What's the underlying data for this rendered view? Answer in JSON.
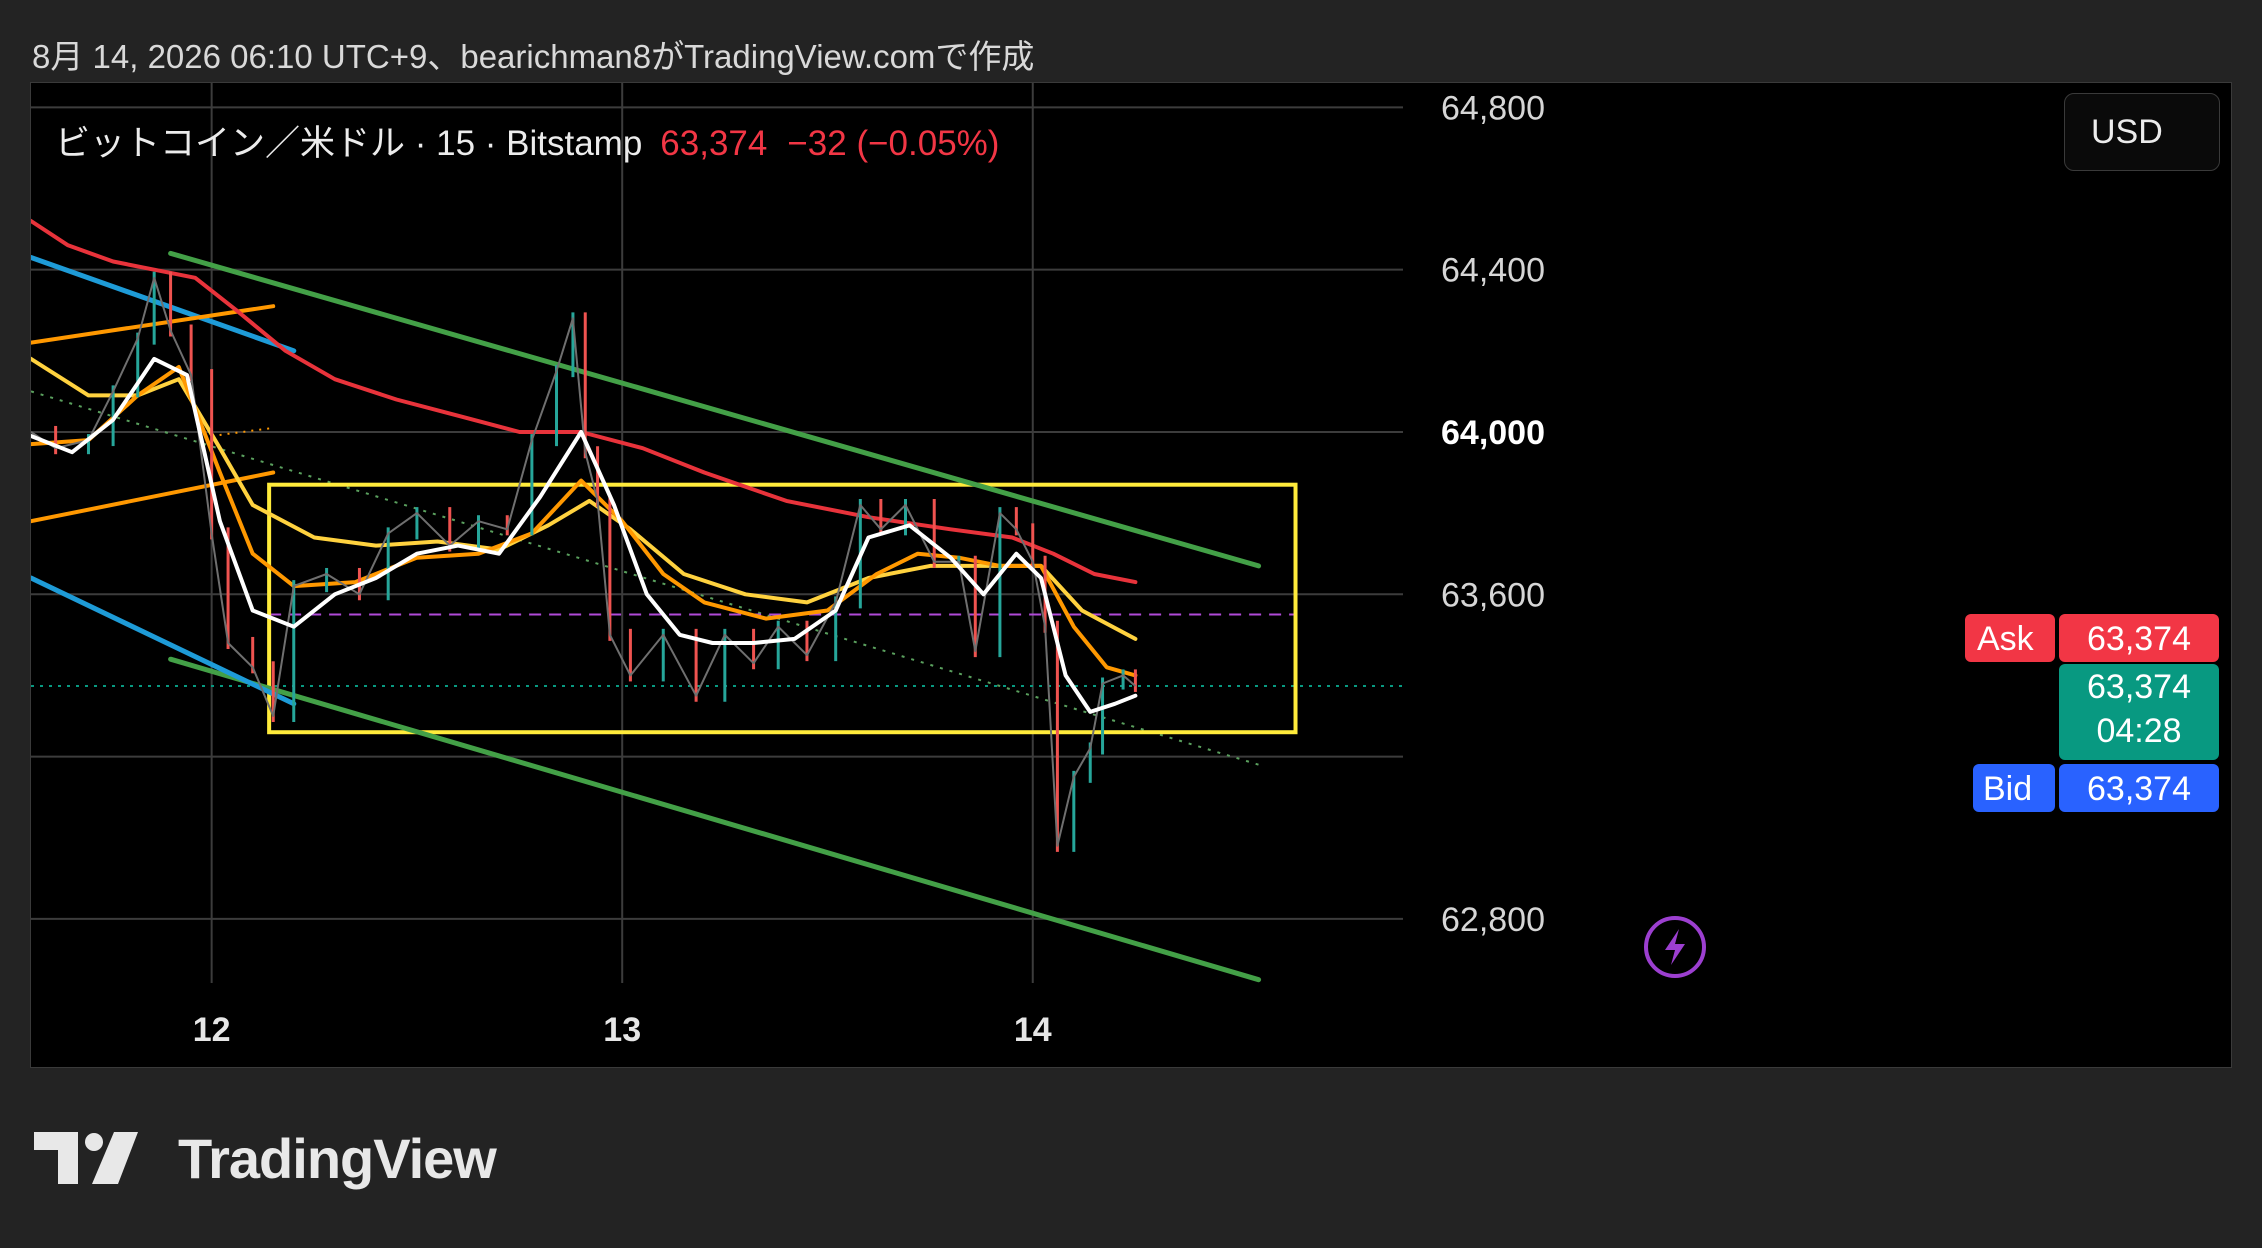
{
  "header": {
    "caption": "8月 14, 2026 06:10 UTC+9、bearichman8がTradingView.comで作成"
  },
  "legend": {
    "symbol": "ビットコイン／米ドル · 15 · Bitstamp",
    "last_price": "63,374",
    "change": "−32 (−0.05%)"
  },
  "currency_button": "USD",
  "badges": {
    "ask_label": "Ask",
    "ask_price": "63,374",
    "last_price": "63,374",
    "countdown": "04:28",
    "bid_label": "Bid",
    "bid_price": "63,374"
  },
  "footer": {
    "logo_text": "TradingView"
  },
  "colors": {
    "background": "#000000",
    "red_line": "#e8333b",
    "white_line": "#ffffff",
    "yellow_line": "#ffd23f",
    "orange_line": "#ff9800",
    "green_line": "#43a047",
    "cyan_line": "#1e9bd7",
    "box": "#ffeb3b",
    "ask": "#f23645",
    "bid": "#2962ff",
    "last": "#089981",
    "dashed_purple": "#b04ad8"
  },
  "chart_data": {
    "type": "line",
    "title": "",
    "instrument": "ビットコイン／米ドル",
    "timeframe": "15",
    "exchange": "Bitstamp",
    "x_labels": [
      "12",
      "13",
      "14"
    ],
    "y_ticks": [
      62800,
      63200,
      63600,
      64000,
      64400,
      64800
    ],
    "y_tick_labels": [
      "62,800",
      "63,600",
      "64,000",
      "64,400",
      "64,800"
    ],
    "highlighted_tick": 64000,
    "ylim": [
      62430,
      64860
    ],
    "xlim": [
      11.56,
      14.97
    ],
    "grid": true,
    "last_price": 63374,
    "series": [
      {
        "name": "",
        "style": "close",
        "values": [
          [
            11.56,
            64000
          ],
          [
            11.62,
            63960
          ],
          [
            11.7,
            63980
          ],
          [
            11.76,
            64100
          ],
          [
            11.82,
            64230
          ],
          [
            11.86,
            64380
          ],
          [
            11.9,
            64250
          ],
          [
            11.95,
            64140
          ],
          [
            12.0,
            63750
          ],
          [
            12.04,
            63480
          ],
          [
            12.1,
            63420
          ],
          [
            12.15,
            63300
          ],
          [
            12.2,
            63620
          ],
          [
            12.28,
            63650
          ],
          [
            12.36,
            63600
          ],
          [
            12.43,
            63750
          ],
          [
            12.5,
            63800
          ],
          [
            12.58,
            63720
          ],
          [
            12.65,
            63780
          ],
          [
            12.72,
            63760
          ],
          [
            12.78,
            63980
          ],
          [
            12.84,
            64150
          ],
          [
            12.88,
            64280
          ],
          [
            12.91,
            63950
          ],
          [
            12.94,
            63830
          ],
          [
            12.97,
            63500
          ],
          [
            13.02,
            63400
          ],
          [
            13.1,
            63500
          ],
          [
            13.18,
            63350
          ],
          [
            13.25,
            63500
          ],
          [
            13.32,
            63430
          ],
          [
            13.38,
            63520
          ],
          [
            13.45,
            63450
          ],
          [
            13.52,
            63580
          ],
          [
            13.58,
            63820
          ],
          [
            13.63,
            63760
          ],
          [
            13.69,
            63820
          ],
          [
            13.76,
            63680
          ],
          [
            13.82,
            63680
          ],
          [
            13.86,
            63460
          ],
          [
            13.92,
            63800
          ],
          [
            13.96,
            63760
          ],
          [
            14.0,
            63680
          ],
          [
            14.03,
            63520
          ],
          [
            14.06,
            62980
          ],
          [
            14.1,
            63150
          ],
          [
            14.14,
            63220
          ],
          [
            14.17,
            63380
          ],
          [
            14.22,
            63400
          ],
          [
            14.25,
            63374
          ]
        ]
      },
      {
        "name": "",
        "style": "white",
        "values": [
          [
            11.56,
            63990
          ],
          [
            11.66,
            63950
          ],
          [
            11.76,
            64030
          ],
          [
            11.86,
            64180
          ],
          [
            11.94,
            64140
          ],
          [
            12.02,
            63780
          ],
          [
            12.1,
            63560
          ],
          [
            12.2,
            63520
          ],
          [
            12.3,
            63600
          ],
          [
            12.4,
            63640
          ],
          [
            12.5,
            63700
          ],
          [
            12.6,
            63720
          ],
          [
            12.7,
            63700
          ],
          [
            12.8,
            63840
          ],
          [
            12.9,
            64000
          ],
          [
            12.98,
            63820
          ],
          [
            13.06,
            63600
          ],
          [
            13.14,
            63500
          ],
          [
            13.22,
            63480
          ],
          [
            13.32,
            63480
          ],
          [
            13.42,
            63490
          ],
          [
            13.52,
            63560
          ],
          [
            13.6,
            63740
          ],
          [
            13.7,
            63770
          ],
          [
            13.8,
            63690
          ],
          [
            13.88,
            63600
          ],
          [
            13.96,
            63700
          ],
          [
            14.02,
            63640
          ],
          [
            14.08,
            63400
          ],
          [
            14.14,
            63310
          ],
          [
            14.2,
            63330
          ],
          [
            14.25,
            63350
          ]
        ]
      },
      {
        "name": "",
        "style": "orange",
        "values": [
          [
            11.56,
            63970
          ],
          [
            11.7,
            63980
          ],
          [
            11.82,
            64090
          ],
          [
            11.92,
            64160
          ],
          [
            12.02,
            63900
          ],
          [
            12.1,
            63700
          ],
          [
            12.2,
            63620
          ],
          [
            12.35,
            63630
          ],
          [
            12.5,
            63690
          ],
          [
            12.65,
            63700
          ],
          [
            12.78,
            63750
          ],
          [
            12.9,
            63880
          ],
          [
            13.0,
            63780
          ],
          [
            13.1,
            63650
          ],
          [
            13.2,
            63580
          ],
          [
            13.35,
            63540
          ],
          [
            13.5,
            63560
          ],
          [
            13.62,
            63650
          ],
          [
            13.72,
            63700
          ],
          [
            13.82,
            63690
          ],
          [
            13.92,
            63670
          ],
          [
            14.02,
            63670
          ],
          [
            14.1,
            63520
          ],
          [
            14.18,
            63420
          ],
          [
            14.25,
            63400
          ]
        ]
      },
      {
        "name": "",
        "style": "yellow",
        "values": [
          [
            11.56,
            64180
          ],
          [
            11.7,
            64090
          ],
          [
            11.82,
            64090
          ],
          [
            11.92,
            64130
          ],
          [
            12.02,
            63960
          ],
          [
            12.1,
            63820
          ],
          [
            12.25,
            63740
          ],
          [
            12.4,
            63720
          ],
          [
            12.55,
            63730
          ],
          [
            12.7,
            63710
          ],
          [
            12.82,
            63770
          ],
          [
            12.92,
            63830
          ],
          [
            13.02,
            63760
          ],
          [
            13.15,
            63650
          ],
          [
            13.3,
            63600
          ],
          [
            13.45,
            63580
          ],
          [
            13.6,
            63640
          ],
          [
            13.75,
            63670
          ],
          [
            13.9,
            63670
          ],
          [
            14.02,
            63670
          ],
          [
            14.12,
            63560
          ],
          [
            14.25,
            63490
          ]
        ]
      },
      {
        "name": "",
        "style": "red",
        "values": [
          [
            11.56,
            64520
          ],
          [
            11.65,
            64460
          ],
          [
            11.76,
            64420
          ],
          [
            11.86,
            64400
          ],
          [
            11.96,
            64380
          ],
          [
            12.06,
            64300
          ],
          [
            12.18,
            64200
          ],
          [
            12.3,
            64130
          ],
          [
            12.45,
            64080
          ],
          [
            12.6,
            64040
          ],
          [
            12.75,
            64000
          ],
          [
            12.9,
            64000
          ],
          [
            13.05,
            63960
          ],
          [
            13.2,
            63900
          ],
          [
            13.4,
            63830
          ],
          [
            13.6,
            63790
          ],
          [
            13.8,
            63760
          ],
          [
            13.95,
            63740
          ],
          [
            14.05,
            63700
          ],
          [
            14.15,
            63650
          ],
          [
            14.25,
            63630
          ]
        ]
      },
      {
        "name": "",
        "style": "green_channel_upper",
        "values": [
          [
            11.9,
            64440
          ],
          [
            14.55,
            63670
          ]
        ]
      },
      {
        "name": "",
        "style": "green_channel_lower",
        "values": [
          [
            11.9,
            63440
          ],
          [
            14.55,
            62650
          ]
        ]
      },
      {
        "name": "",
        "style": "cyan_upper",
        "values": [
          [
            11.56,
            64430
          ],
          [
            12.2,
            64200
          ]
        ]
      },
      {
        "name": "",
        "style": "cyan_lower",
        "values": [
          [
            11.56,
            63640
          ],
          [
            12.2,
            63330
          ]
        ]
      },
      {
        "name": "",
        "style": "orange_channel_upper",
        "values": [
          [
            11.56,
            64220
          ],
          [
            12.15,
            64310
          ]
        ]
      },
      {
        "name": "",
        "style": "orange_channel_lower",
        "values": [
          [
            11.56,
            63780
          ],
          [
            12.15,
            63900
          ]
        ]
      }
    ],
    "annotations": {
      "range_box": {
        "x": [
          12.14,
          14.64
        ],
        "y": [
          63260,
          63870
        ]
      },
      "dashed_level": 63550,
      "dotted_last_level": 63374,
      "dotted_trend": [
        [
          11.56,
          64100
        ],
        [
          14.55,
          63180
        ]
      ],
      "orange_dotted": [
        [
          12.0,
          63990
        ],
        [
          12.15,
          64010
        ]
      ]
    }
  }
}
